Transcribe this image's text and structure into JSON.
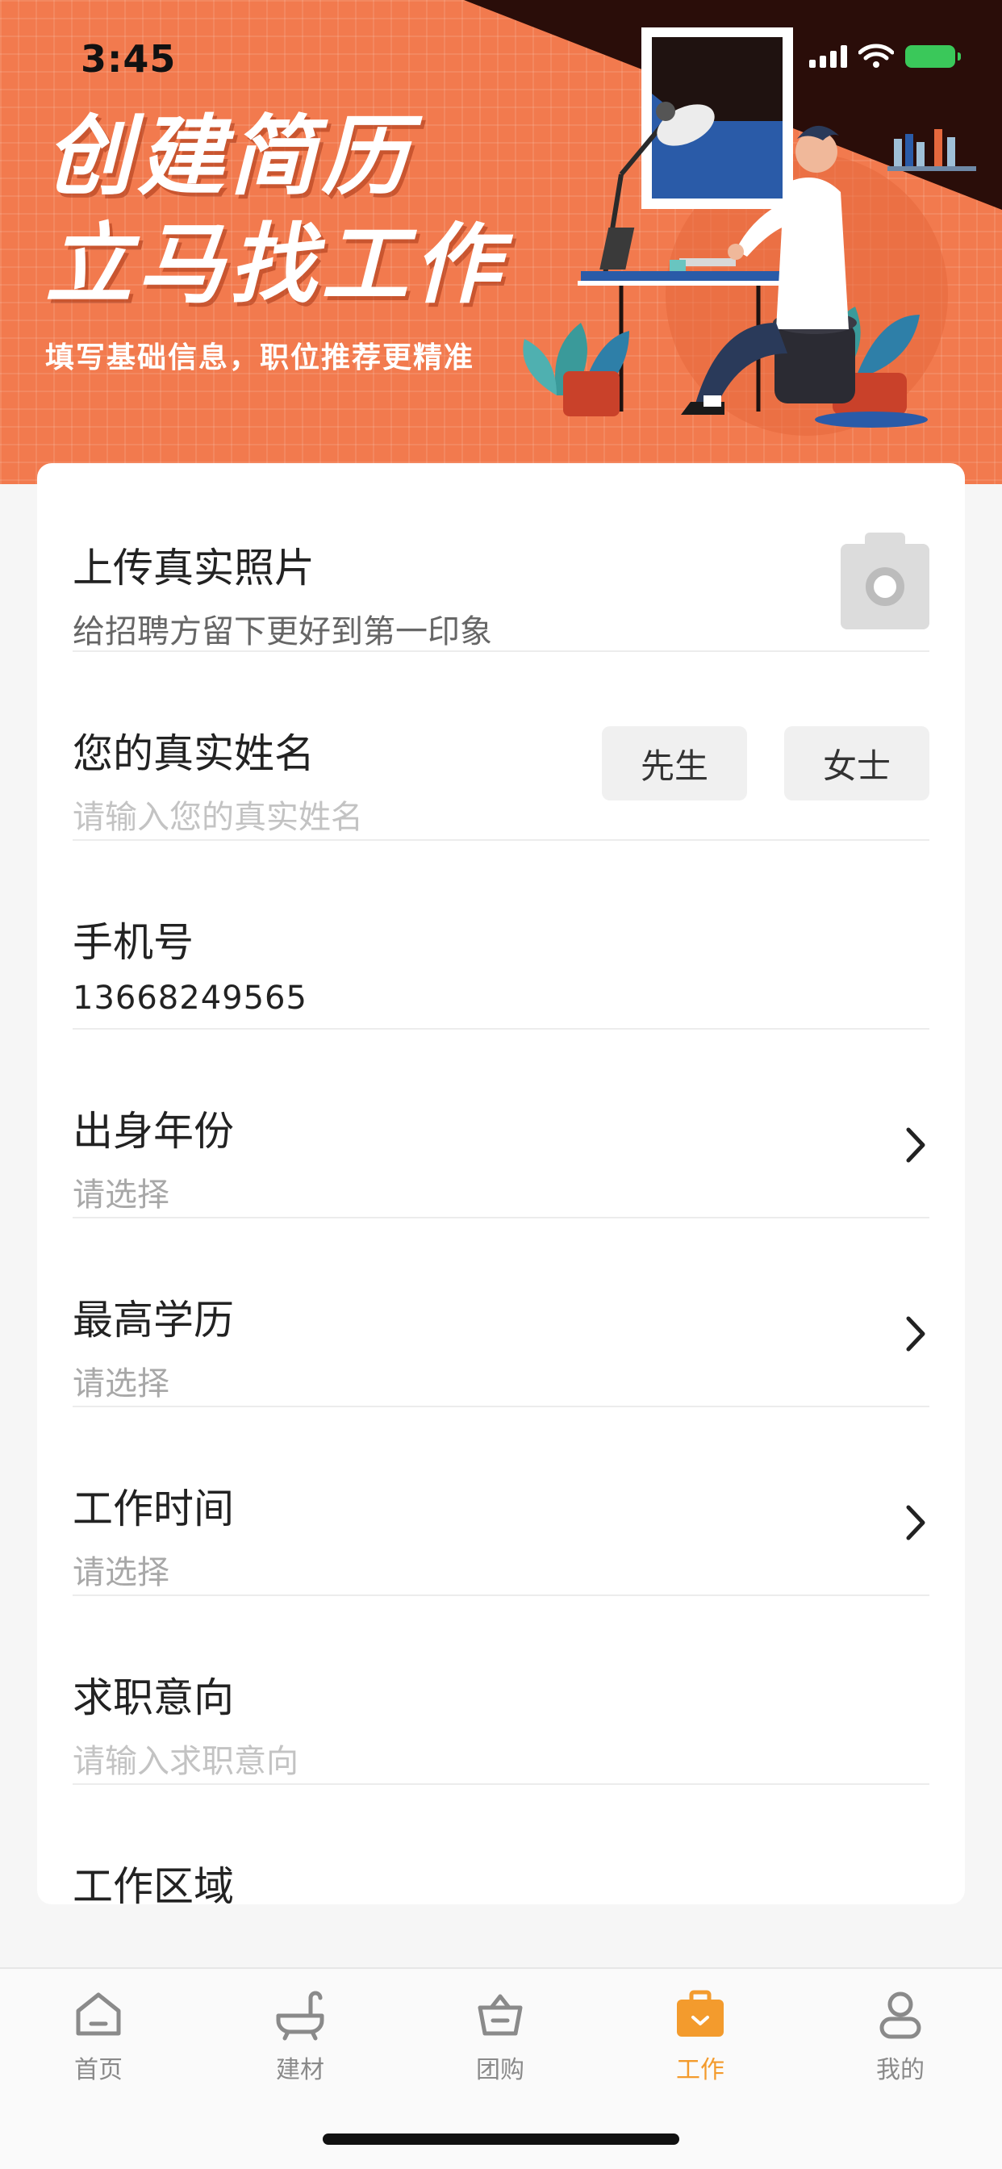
{
  "status_bar": {
    "time": "3:45"
  },
  "banner": {
    "headline_line1": "创建简历",
    "headline_line2": "立马找工作",
    "subtitle": "填写基础信息，职位推荐更精准"
  },
  "form": {
    "photo": {
      "label": "上传真实照片",
      "hint": "给招聘方留下更好到第一印象"
    },
    "name": {
      "label": "您的真实姓名",
      "placeholder": "请输入您的真实姓名",
      "option_mr": "先生",
      "option_ms": "女士"
    },
    "phone": {
      "label": "手机号",
      "value": "13668249565"
    },
    "birth_year": {
      "label": "出身年份",
      "placeholder": "请选择"
    },
    "education": {
      "label": "最高学历",
      "placeholder": "请选择"
    },
    "work_time": {
      "label": "工作时间",
      "placeholder": "请选择"
    },
    "job_intent": {
      "label": "求职意向",
      "placeholder": "请输入求职意向"
    },
    "work_area": {
      "label": "工作区域"
    }
  },
  "tabbar": {
    "items": [
      {
        "label": "首页",
        "icon": "home-icon"
      },
      {
        "label": "建材",
        "icon": "bathtub-icon"
      },
      {
        "label": "团购",
        "icon": "basket-icon"
      },
      {
        "label": "工作",
        "icon": "briefcase-icon"
      },
      {
        "label": "我的",
        "icon": "user-icon"
      }
    ],
    "active_index": 3
  },
  "colors": {
    "banner": "#f27a4e",
    "banner_dark": "#2a0d09",
    "accent": "#f39b2d",
    "background": "#f6f6f6"
  }
}
